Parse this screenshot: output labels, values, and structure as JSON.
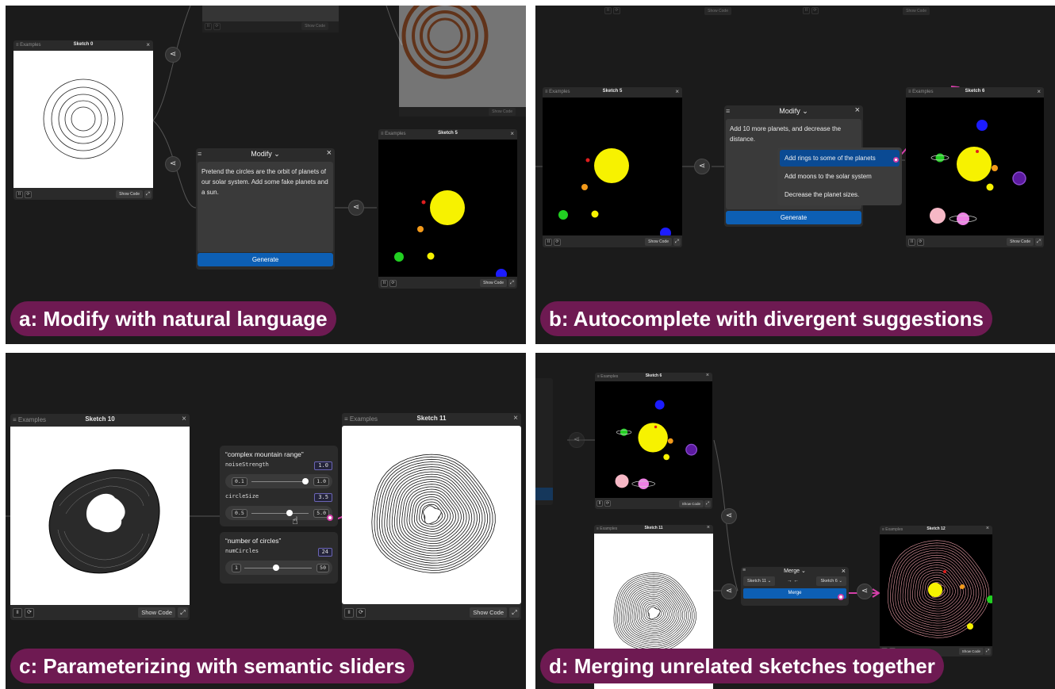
{
  "panel_a": {
    "caption": "a: Modify with natural language",
    "sketch0": {
      "examples": "≡ Examples",
      "title": "Sketch 0",
      "show_code": "Show Code"
    },
    "ghost_a": {
      "show_code": "Show Code"
    },
    "ghost_b": {
      "show_code": "Show Code"
    },
    "modify": {
      "title": "Modify ⌄",
      "prompt": "Pretend the circles are the orbit of planets of our solar system. Add some fake planets and a sun.",
      "generate": "Generate"
    },
    "sketch5": {
      "examples": "≡ Examples",
      "title": "Sketch 5",
      "show_code": "Show Code"
    }
  },
  "panel_b": {
    "caption": "b: Autocomplete with divergent suggestions",
    "ghost_top": {
      "show_code_1": "Show Code",
      "show_code_2": "Show Code"
    },
    "sketch5": {
      "examples": "≡ Examples",
      "title": "Sketch 5",
      "show_code": "Show Code"
    },
    "modify": {
      "title": "Modify ⌄",
      "prompt": "Add 10 more planets, and decrease the distance.",
      "generate": "Generate"
    },
    "suggestions": [
      "Add rings to some of the planets",
      "Add moons to the solar system",
      "Decrease the planet sizes."
    ],
    "sketch6": {
      "examples": "≡ Examples",
      "title": "Sketch 6",
      "show_code": "Show Code"
    }
  },
  "panel_c": {
    "caption": "c: Parameterizing with semantic sliders",
    "sketch10": {
      "examples": "≡ Examples",
      "title": "Sketch 10",
      "show_code": "Show Code"
    },
    "slider_group1": {
      "title": "“complex mountain range”",
      "params": [
        {
          "name": "noiseStrength",
          "value": "1.0",
          "min": "0.1",
          "max": "1.0",
          "position": 0.95
        },
        {
          "name": "circleSize",
          "value": "3.5",
          "min": "0.5",
          "max": "5.0",
          "position": 0.66
        }
      ]
    },
    "slider_group2": {
      "title": "“number of circles”",
      "params": [
        {
          "name": "numCircles",
          "value": "24",
          "min": "1",
          "max": "50",
          "position": 0.47
        }
      ]
    },
    "sketch11": {
      "examples": "≡ Examples",
      "title": "Sketch 11",
      "show_code": "Show Code"
    }
  },
  "panel_d": {
    "caption": "d: Merging unrelated sketches together",
    "sketch6": {
      "examples": "≡ Examples",
      "title": "Sketch 6",
      "show_code": "Show Code"
    },
    "sketch11": {
      "examples": "≡ Examples",
      "title": "Sketch 11"
    },
    "merge": {
      "title": "Merge ⌄",
      "left_select": "Sketch 11 ⌄",
      "arrows": "→ ←",
      "right_select": "Sketch 6 ⌄",
      "button": "Merge"
    },
    "sketch12": {
      "examples": "≡ Examples",
      "title": "Sketch 12",
      "show_code": "Show Code"
    }
  },
  "colors": {
    "panel_bg": "#1b1b1b",
    "caption_bg": "#6e1a52",
    "accent_blue": "#0d5fb4",
    "arrow_pink": "#d33fa8"
  },
  "icons": [
    "share-icon",
    "pause-icon",
    "restart-icon",
    "expand-icon",
    "close-icon",
    "menu-icon",
    "cursor-hand-icon"
  ]
}
